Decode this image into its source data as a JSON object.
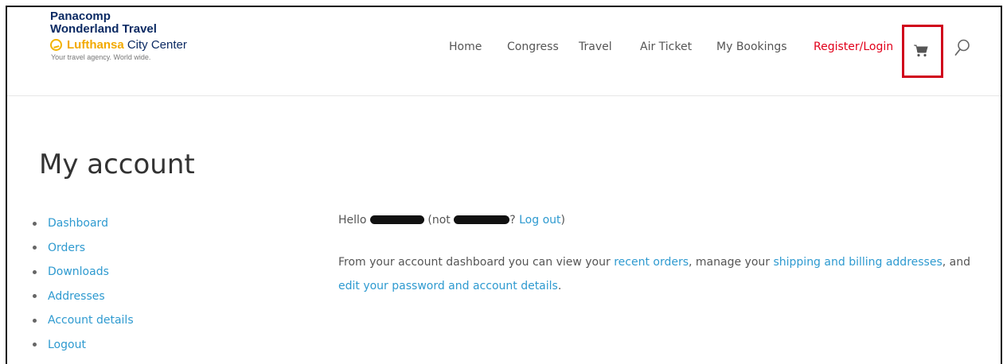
{
  "logo": {
    "line1": "Panacomp",
    "line2": "Wonderland Travel",
    "brand_bold": "Lufthansa",
    "brand_rest": " City Center",
    "tagline": "Your travel agency. World wide."
  },
  "nav": {
    "items": [
      "Home",
      "Congress",
      "Travel",
      "Air Ticket",
      "My Bookings"
    ],
    "register_label": "Register/Login",
    "highlight_color": "#d0021b",
    "cart_icon": "cart-icon",
    "search_icon": "search-icon"
  },
  "page": {
    "title": "My account"
  },
  "account_nav": {
    "items": [
      "Dashboard",
      "Orders",
      "Downloads",
      "Addresses",
      "Account details",
      "Logout"
    ]
  },
  "greeting": {
    "hello": "Hello ",
    "not_open": " (not ",
    "question": "? ",
    "logout": "Log out",
    "close": ")"
  },
  "dashboard_text": {
    "part1": "From your account dashboard you can view your ",
    "link1": "recent orders",
    "part2": ", manage your ",
    "link2": "shipping and billing addresses",
    "part3": ", and ",
    "link3": "edit your password and account details",
    "part4": "."
  },
  "colors": {
    "link": "#2e9ad0",
    "register": "#e1001a",
    "brand_navy": "#0b2a63",
    "brand_yellow": "#f2a900"
  }
}
